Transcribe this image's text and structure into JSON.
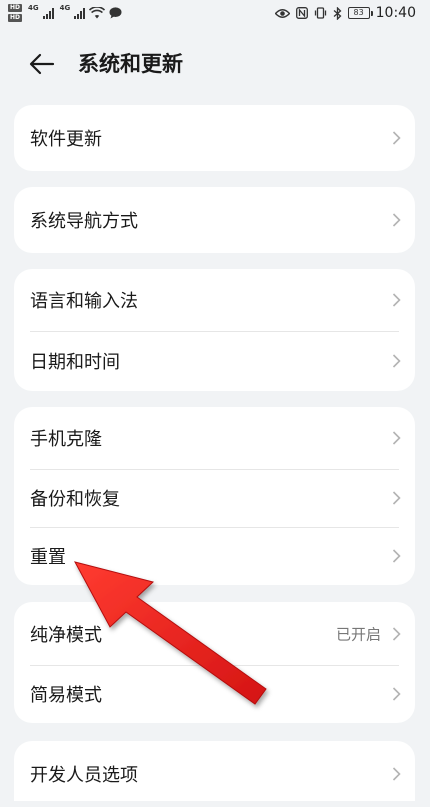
{
  "status_bar": {
    "hd1": "HD",
    "hd2": "HD",
    "net1": "4G",
    "net2": "4G",
    "battery": "83",
    "time": "10:40"
  },
  "header": {
    "title": "系统和更新"
  },
  "groups": [
    {
      "items": [
        {
          "label": "软件更新"
        }
      ]
    },
    {
      "items": [
        {
          "label": "系统导航方式"
        }
      ]
    },
    {
      "items": [
        {
          "label": "语言和输入法"
        },
        {
          "label": "日期和时间"
        }
      ]
    },
    {
      "items": [
        {
          "label": "手机克隆"
        },
        {
          "label": "备份和恢复"
        },
        {
          "label": "重置"
        }
      ]
    },
    {
      "items": [
        {
          "label": "纯净模式",
          "value": "已开启"
        },
        {
          "label": "简易模式"
        }
      ]
    },
    {
      "items": [
        {
          "label": "开发人员选项"
        }
      ]
    }
  ],
  "colors": {
    "background": "#f1f3f5",
    "card": "#ffffff",
    "annotation_arrow": "#e51c1c"
  }
}
